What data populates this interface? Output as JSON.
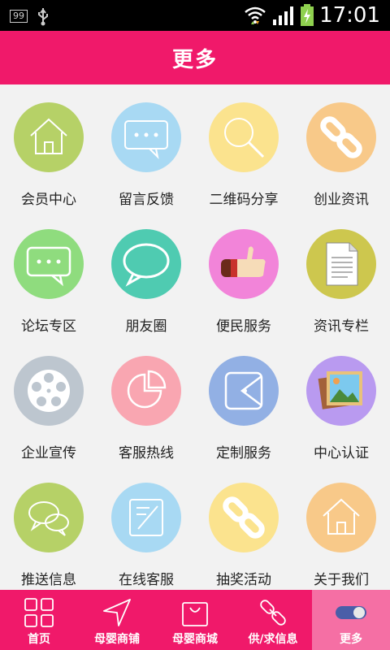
{
  "status_bar": {
    "badge": "99",
    "time": "17:01"
  },
  "header": {
    "title": "更多"
  },
  "grid": [
    {
      "label": "会员中心",
      "icon": "home-icon",
      "color": "#b6d167"
    },
    {
      "label": "留言反馈",
      "icon": "chat-bubble-icon",
      "color": "#a8d9f3"
    },
    {
      "label": "二维码分享",
      "icon": "magnifier-icon",
      "color": "#fbe38e"
    },
    {
      "label": "创业资讯",
      "icon": "chain-link-icon",
      "color": "#f8c989"
    },
    {
      "label": "论坛专区",
      "icon": "forum-bubble-icon",
      "color": "#8fdc7e"
    },
    {
      "label": "朋友圈",
      "icon": "speech-bubble-icon",
      "color": "#4fcbb1"
    },
    {
      "label": "便民服务",
      "icon": "thumbs-up-icon",
      "color": "#f284d9"
    },
    {
      "label": "资讯专栏",
      "icon": "document-icon",
      "color": "#cdc74e"
    },
    {
      "label": "企业宣传",
      "icon": "film-reel-icon",
      "color": "#bdc6cf"
    },
    {
      "label": "客服热线",
      "icon": "pie-chart-icon",
      "color": "#f9a6b1"
    },
    {
      "label": "定制服务",
      "icon": "wallet-icon",
      "color": "#92b0e4"
    },
    {
      "label": "中心认证",
      "icon": "picture-icon",
      "color": "#b99af0"
    },
    {
      "label": "推送信息",
      "icon": "double-chat-icon",
      "color": "#b6d167"
    },
    {
      "label": "在线客服",
      "icon": "edit-note-icon",
      "color": "#a8d9f3"
    },
    {
      "label": "抽奖活动",
      "icon": "chain-link-icon",
      "color": "#fbe38e"
    },
    {
      "label": "关于我们",
      "icon": "home-icon",
      "color": "#f8c989"
    }
  ],
  "tabbar": [
    {
      "label": "首页",
      "icon": "grid-icon"
    },
    {
      "label": "母婴商铺",
      "icon": "navigation-arrow-icon"
    },
    {
      "label": "母婴商城",
      "icon": "shopping-bag-icon"
    },
    {
      "label": "供/求信息",
      "icon": "link-icon"
    },
    {
      "label": "更多",
      "icon": "toggle-icon",
      "active": true
    }
  ]
}
